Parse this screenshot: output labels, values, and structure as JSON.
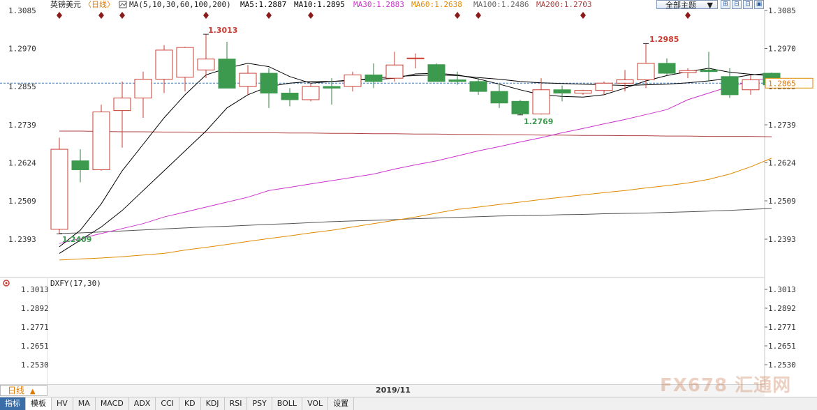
{
  "header": {
    "symbol": "英镑美元",
    "period_tag": "〈日线〉",
    "ma_params": "MA(5,10,30,60,100,200)",
    "ma5": "MA5:1.2887",
    "ma10": "MA10:1.2895",
    "ma30": "MA30:1.2883",
    "ma60": "MA60:1.2638",
    "ma100": "MA100:1.2486",
    "ma200": "MA200:1.2703",
    "theme_button": "全部主题",
    "theme_arrow": "▼",
    "icon_buttons": [
      "⊞",
      "⊟",
      "⊡",
      "▣"
    ]
  },
  "colors": {
    "up": "#c83c32",
    "down": "#3c9a4e",
    "ma5": "#000000",
    "ma10": "#000000",
    "ma30": "#cc33cc",
    "ma60": "#e08a00",
    "ma100": "#555555",
    "ma200": "#b04040",
    "current_line": "#3a7abf"
  },
  "chart_data": {
    "type": "candlestick",
    "price_axis": {
      "ticks": [
        "1.3085",
        "1.2970",
        "1.2855",
        "1.2739",
        "1.2624",
        "1.2509",
        "1.2393"
      ],
      "tick_values": [
        1.3085,
        1.297,
        1.2855,
        1.2739,
        1.2624,
        1.2509,
        1.2393
      ],
      "range": [
        1.233,
        1.3085
      ]
    },
    "current_price": "1.2865",
    "annotations": {
      "high1": "1.3013",
      "high2": "1.2985",
      "low1": "1.2409",
      "low2": "1.2769"
    },
    "candles": [
      {
        "o": 1.2423,
        "h": 1.27,
        "l": 1.2409,
        "c": 1.2665
      },
      {
        "o": 1.263,
        "h": 1.2665,
        "l": 1.2565,
        "c": 1.2603
      },
      {
        "o": 1.2603,
        "h": 1.28,
        "l": 1.26,
        "c": 1.2778
      },
      {
        "o": 1.2782,
        "h": 1.287,
        "l": 1.267,
        "c": 1.282
      },
      {
        "o": 1.282,
        "h": 1.29,
        "l": 1.276,
        "c": 1.2877
      },
      {
        "o": 1.2877,
        "h": 1.298,
        "l": 1.2835,
        "c": 1.2965
      },
      {
        "o": 1.2883,
        "h": 1.2975,
        "l": 1.284,
        "c": 1.2973
      },
      {
        "o": 1.2905,
        "h": 1.3013,
        "l": 1.288,
        "c": 1.2938
      },
      {
        "o": 1.2938,
        "h": 1.299,
        "l": 1.287,
        "c": 1.285
      },
      {
        "o": 1.2855,
        "h": 1.292,
        "l": 1.283,
        "c": 1.2895
      },
      {
        "o": 1.2895,
        "h": 1.291,
        "l": 1.279,
        "c": 1.2835
      },
      {
        "o": 1.2835,
        "h": 1.285,
        "l": 1.2795,
        "c": 1.2815
      },
      {
        "o": 1.2815,
        "h": 1.2865,
        "l": 1.281,
        "c": 1.2855
      },
      {
        "o": 1.2855,
        "h": 1.288,
        "l": 1.28,
        "c": 1.285
      },
      {
        "o": 1.2855,
        "h": 1.29,
        "l": 1.284,
        "c": 1.289
      },
      {
        "o": 1.289,
        "h": 1.2925,
        "l": 1.285,
        "c": 1.287
      },
      {
        "o": 1.288,
        "h": 1.296,
        "l": 1.287,
        "c": 1.292
      },
      {
        "o": 1.294,
        "h": 1.2955,
        "l": 1.291,
        "c": 1.2941
      },
      {
        "o": 1.2921,
        "h": 1.2925,
        "l": 1.287,
        "c": 1.287
      },
      {
        "o": 1.2875,
        "h": 1.29,
        "l": 1.286,
        "c": 1.287
      },
      {
        "o": 1.287,
        "h": 1.288,
        "l": 1.283,
        "c": 1.284
      },
      {
        "o": 1.284,
        "h": 1.286,
        "l": 1.279,
        "c": 1.2805
      },
      {
        "o": 1.281,
        "h": 1.2815,
        "l": 1.2769,
        "c": 1.2772
      },
      {
        "o": 1.2772,
        "h": 1.288,
        "l": 1.277,
        "c": 1.2845
      },
      {
        "o": 1.2845,
        "h": 1.2858,
        "l": 1.281,
        "c": 1.2835
      },
      {
        "o": 1.2835,
        "h": 1.2845,
        "l": 1.283,
        "c": 1.2843
      },
      {
        "o": 1.2843,
        "h": 1.287,
        "l": 1.283,
        "c": 1.2865
      },
      {
        "o": 1.2865,
        "h": 1.2905,
        "l": 1.284,
        "c": 1.2875
      },
      {
        "o": 1.2875,
        "h": 1.2985,
        "l": 1.285,
        "c": 1.2925
      },
      {
        "o": 1.2925,
        "h": 1.294,
        "l": 1.289,
        "c": 1.2895
      },
      {
        "o": 1.2897,
        "h": 1.291,
        "l": 1.288,
        "c": 1.2903
      },
      {
        "o": 1.2905,
        "h": 1.296,
        "l": 1.287,
        "c": 1.29
      },
      {
        "o": 1.2885,
        "h": 1.291,
        "l": 1.282,
        "c": 1.283
      },
      {
        "o": 1.2845,
        "h": 1.289,
        "l": 1.283,
        "c": 1.2875
      },
      {
        "o": 1.2895,
        "h": 1.2897,
        "l": 1.2858,
        "c": 1.286
      }
    ],
    "ma5": [
      1.237,
      1.242,
      1.25,
      1.26,
      1.268,
      1.276,
      1.283,
      1.289,
      1.291,
      1.2925,
      1.2915,
      1.2885,
      1.2865,
      1.287,
      1.2875,
      1.2876,
      1.288,
      1.2893,
      1.2895,
      1.289,
      1.2878,
      1.2862,
      1.2845,
      1.283,
      1.2825,
      1.2823,
      1.283,
      1.285,
      1.2872,
      1.2888,
      1.29,
      1.291,
      1.2898,
      1.2892,
      1.2887
    ],
    "ma10": [
      1.235,
      1.239,
      1.243,
      1.248,
      1.254,
      1.26,
      1.266,
      1.272,
      1.279,
      1.283,
      1.2855,
      1.2865,
      1.287,
      1.287,
      1.2873,
      1.288,
      1.2885,
      1.2888,
      1.289,
      1.2888,
      1.2882,
      1.2877,
      1.287,
      1.2866,
      1.2864,
      1.2862,
      1.286,
      1.2858,
      1.286,
      1.2862,
      1.2866,
      1.2872,
      1.288,
      1.289,
      1.2895
    ],
    "ma30": [
      1.238,
      1.2395,
      1.241,
      1.2425,
      1.244,
      1.246,
      1.2475,
      1.249,
      1.2505,
      1.252,
      1.254,
      1.255,
      1.256,
      1.257,
      1.258,
      1.259,
      1.2605,
      1.2618,
      1.263,
      1.2645,
      1.266,
      1.2673,
      1.2687,
      1.27,
      1.2715,
      1.2728,
      1.2742,
      1.2755,
      1.277,
      1.2785,
      1.2815,
      1.2835,
      1.2855,
      1.287,
      1.2883
    ],
    "ma60": [
      1.233,
      1.2333,
      1.2336,
      1.234,
      1.2345,
      1.235,
      1.236,
      1.2368,
      1.2377,
      1.2386,
      1.2395,
      1.2403,
      1.2412,
      1.242,
      1.243,
      1.244,
      1.245,
      1.246,
      1.2472,
      1.2483,
      1.249,
      1.2498,
      1.2505,
      1.2513,
      1.252,
      1.2527,
      1.2534,
      1.254,
      1.2548,
      1.2555,
      1.2563,
      1.2574,
      1.259,
      1.2612,
      1.2638
    ],
    "ma100": [
      1.241,
      1.2412,
      1.2415,
      1.2418,
      1.2421,
      1.2424,
      1.2427,
      1.243,
      1.2432,
      1.2435,
      1.2438,
      1.244,
      1.2443,
      1.2446,
      1.2448,
      1.245,
      1.2452,
      1.2455,
      1.2457,
      1.2459,
      1.2461,
      1.2463,
      1.2464,
      1.2465,
      1.2467,
      1.2468,
      1.247,
      1.2471,
      1.2472,
      1.2474,
      1.2476,
      1.2478,
      1.248,
      1.2483,
      1.2486
    ],
    "ma200": [
      1.272,
      1.272,
      1.2719,
      1.2718,
      1.2718,
      1.2717,
      1.2717,
      1.2716,
      1.2716,
      1.2715,
      1.2715,
      1.2714,
      1.2714,
      1.2713,
      1.2713,
      1.2712,
      1.2712,
      1.2711,
      1.2711,
      1.271,
      1.271,
      1.2709,
      1.2709,
      1.2708,
      1.2708,
      1.2707,
      1.2707,
      1.2706,
      1.2706,
      1.2705,
      1.2705,
      1.2704,
      1.2704,
      1.2704,
      1.2703
    ],
    "event_markers_at": [
      0,
      2,
      3,
      7,
      10,
      12,
      19,
      20,
      25,
      30
    ]
  },
  "sub_chart": {
    "indicator": "DXFY(17,30)",
    "ticks": [
      "1.3013",
      "1.2892",
      "1.2771",
      "1.2651",
      "1.2530"
    ]
  },
  "footer": {
    "period_label": "日线",
    "period_arrow": "▲",
    "date_label": "2019/11",
    "tabs": [
      "指标",
      "模板",
      "HV",
      "MA",
      "MACD",
      "ADX",
      "CCI",
      "KD",
      "KDJ",
      "RSI",
      "PSY",
      "BOLL",
      "VOL",
      "设置"
    ],
    "watermark": "FX678 汇通网"
  }
}
